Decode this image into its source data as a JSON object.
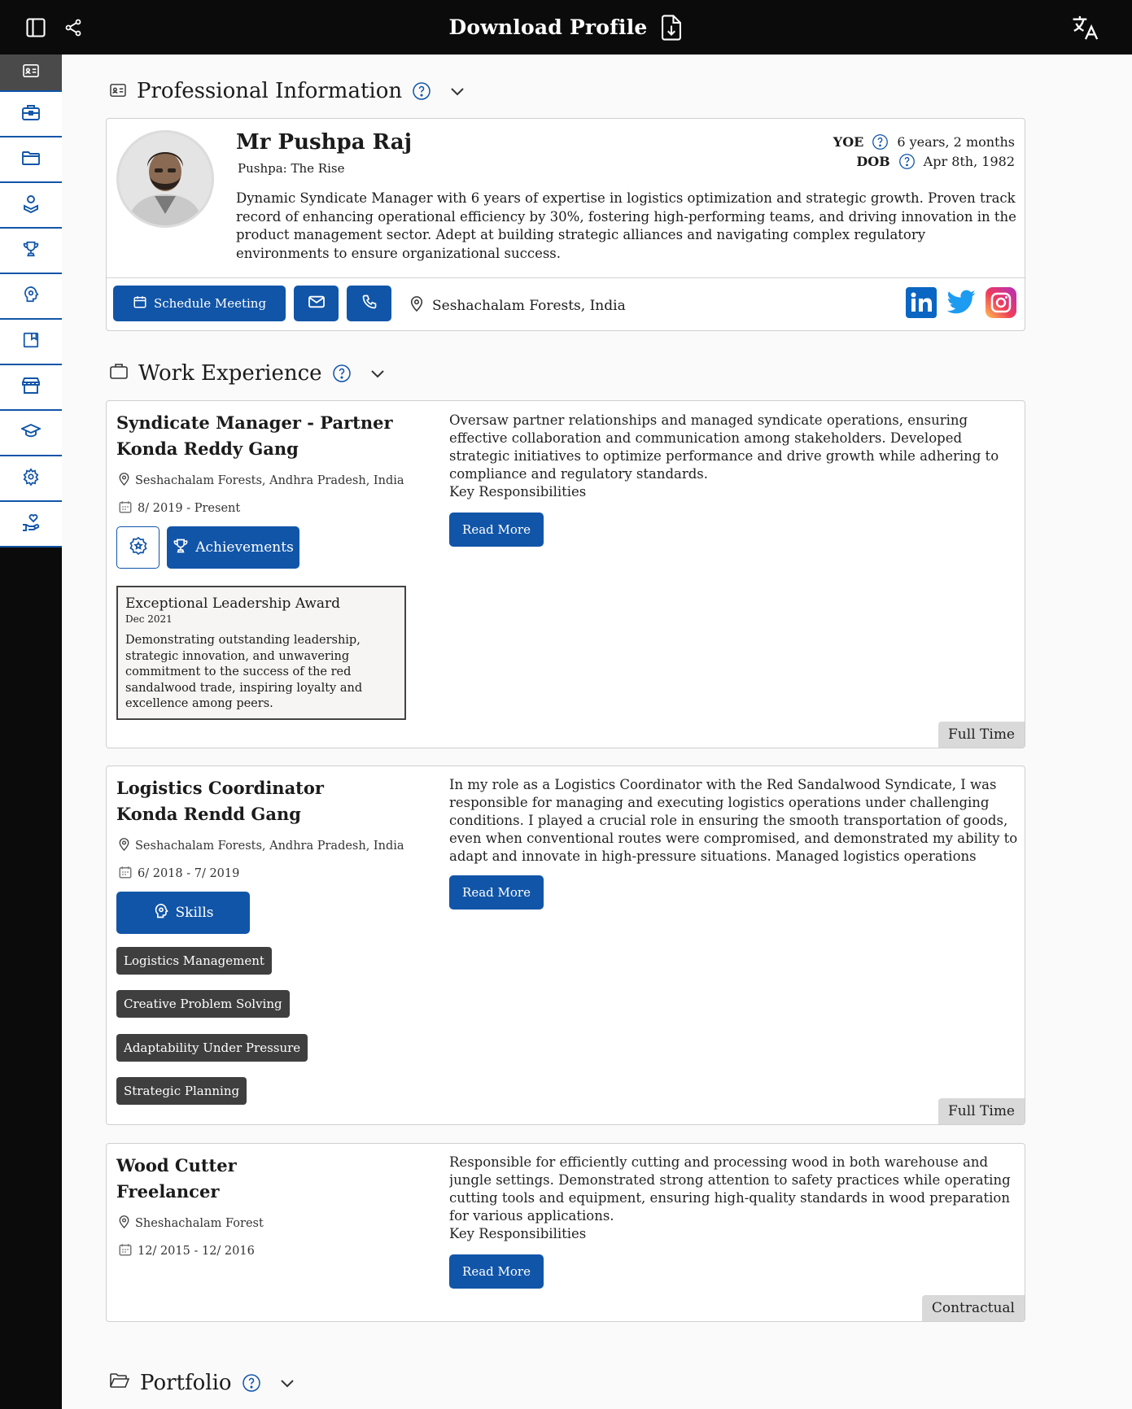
{
  "topbar": {
    "title": "Download Profile"
  },
  "sidebar": {
    "items": [
      {
        "icon": "id-card-icon"
      },
      {
        "icon": "briefcase-icon"
      },
      {
        "icon": "folder-icon"
      },
      {
        "icon": "badge-user-icon"
      },
      {
        "icon": "trophy-icon"
      },
      {
        "icon": "brain-icon"
      },
      {
        "icon": "book-icon"
      },
      {
        "icon": "store-icon"
      },
      {
        "icon": "graduation-cap-icon"
      },
      {
        "icon": "gear-icon"
      },
      {
        "icon": "hand-heart-icon"
      }
    ]
  },
  "professional": {
    "heading": "Professional Information",
    "name": "Mr Pushpa Raj",
    "alias": "Pushpa: The Rise",
    "yoe_label": "YOE",
    "yoe_value": "6 years, 2 months",
    "dob_label": "DOB",
    "dob_value": "Apr 8th, 1982",
    "bio": "Dynamic Syndicate Manager with 6 years of expertise in logistics optimization and strategic growth. Proven track record of enhancing operational efficiency by 30%, fostering high-performing teams, and driving innovation in the product management sector. Adept at building strategic alliances and navigating complex regulatory environments to ensure organizational success.",
    "schedule_label": "Schedule Meeting",
    "location": "Seshachalam Forests, India"
  },
  "work": {
    "heading": "Work Experience",
    "jobs": [
      {
        "role": "Syndicate Manager - Partner",
        "company": "Konda Reddy Gang",
        "location": "Seshachalam Forests, Andhra Pradesh, India",
        "dates": "8/ 2019 - Present",
        "achievements_label": "Achievements",
        "award_title": "Exceptional Leadership Award",
        "award_date": "Dec 2021",
        "award_text": "Demonstrating outstanding leadership, strategic innovation, and unwavering commitment to the success of the red sandalwood trade, inspiring loyalty and excellence among peers.",
        "description": "Oversaw partner relationships and managed syndicate operations, ensuring effective collaboration and communication among stakeholders. Developed strategic initiatives to optimize performance and drive growth while adhering to compliance and regulatory standards.\nKey Responsibilities",
        "read_more": "Read More",
        "type": "Full Time"
      },
      {
        "role": "Logistics Coordinator",
        "company": "Konda Rendd Gang",
        "location": "Seshachalam Forests, Andhra Pradesh, India",
        "dates": "6/ 2018 - 7/ 2019",
        "skills_label": "Skills",
        "skills": [
          "Logistics Management",
          "Creative Problem Solving",
          "Adaptability Under Pressure",
          "Strategic Planning"
        ],
        "description": "In my role as a Logistics Coordinator with the Red Sandalwood Syndicate, I was responsible for managing and executing logistics operations under challenging conditions. I played a crucial role in ensuring the smooth transportation of goods, even when conventional routes were compromised, and demonstrated my ability to adapt and innovate in high-pressure situations. Managed logistics operations under",
        "read_more": "Read More",
        "type": "Full Time"
      },
      {
        "role": "Wood Cutter",
        "company": "Freelancer",
        "location": "Sheshachalam Forest",
        "dates": "12/ 2015 - 12/ 2016",
        "description": "Responsible for efficiently cutting and processing wood in both warehouse and jungle settings. Demonstrated strong attention to safety practices while operating cutting tools and equipment, ensuring high-quality standards in wood preparation for various applications.\nKey Responsibilities",
        "read_more": "Read More",
        "type": "Contractual"
      }
    ]
  },
  "portfolio": {
    "heading": "Portfolio"
  },
  "colors": {
    "primary": "#1155a8",
    "topbar": "#0b0b0b",
    "chip": "#3f3f3f"
  }
}
